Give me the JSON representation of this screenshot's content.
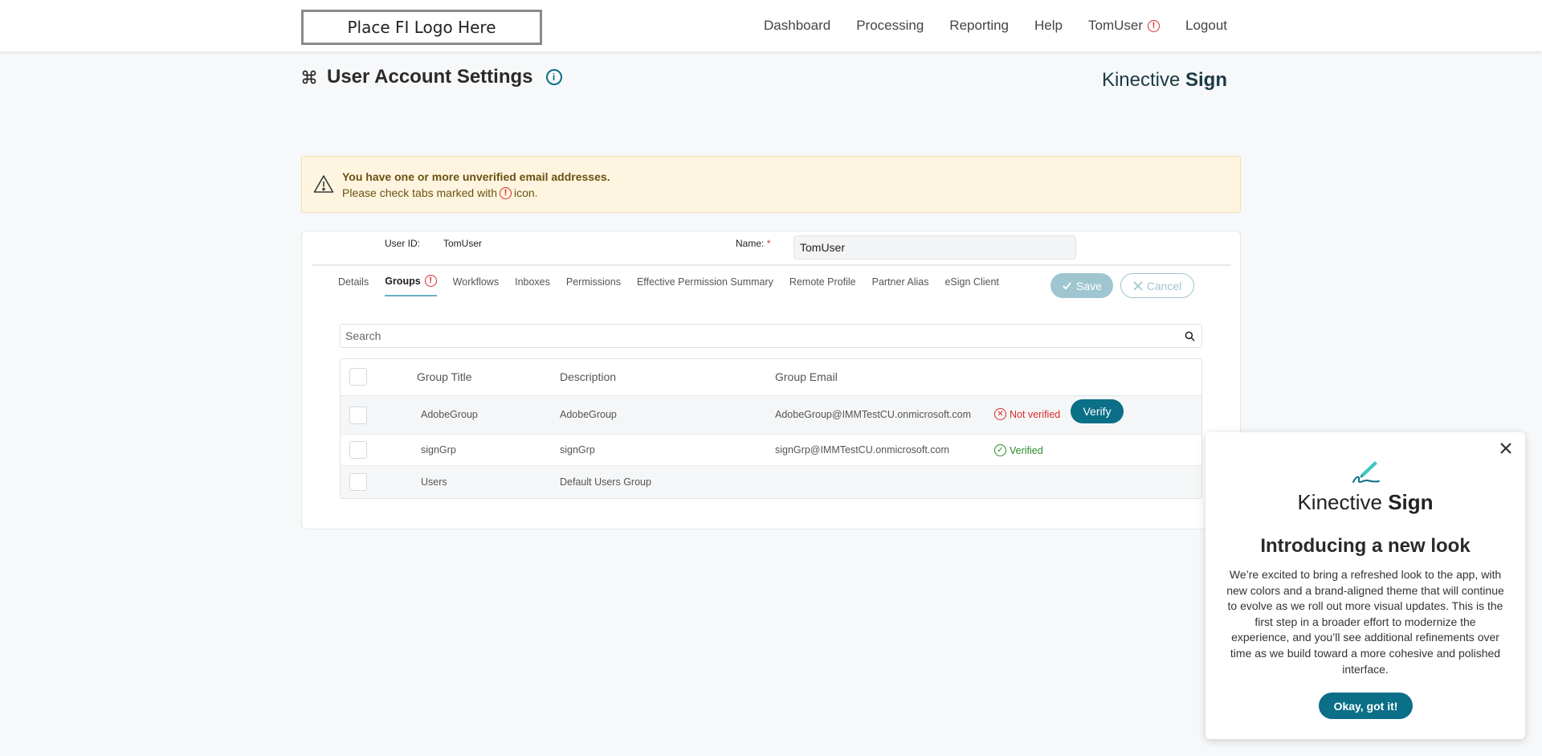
{
  "header": {
    "logo_text": "Place FI Logo Here",
    "nav": [
      {
        "label": "Dashboard"
      },
      {
        "label": "Processing"
      },
      {
        "label": "Reporting"
      },
      {
        "label": "Help"
      },
      {
        "label": "TomUser",
        "alert": true
      },
      {
        "label": "Logout"
      }
    ]
  },
  "page": {
    "title": "User Account Settings",
    "brand": {
      "light": "Kinective",
      "bold": "Sign"
    }
  },
  "warning": {
    "title": "You have one or more unverified email addresses.",
    "sub_before": "Please check tabs marked with",
    "sub_after": "icon."
  },
  "user": {
    "id_label": "User ID:",
    "id_value": "TomUser",
    "name_label": "Name:",
    "name_required": "*",
    "name_value": "TomUser"
  },
  "tabs": [
    {
      "label": "Details",
      "active": false
    },
    {
      "label": "Groups",
      "active": true,
      "alert": true
    },
    {
      "label": "Workflows",
      "active": false
    },
    {
      "label": "Inboxes",
      "active": false
    },
    {
      "label": "Permissions",
      "active": false
    },
    {
      "label": "Effective Permission Summary",
      "active": false
    },
    {
      "label": "Remote Profile",
      "active": false
    },
    {
      "label": "Partner Alias",
      "active": false
    },
    {
      "label": "eSign Client",
      "active": false
    }
  ],
  "actions": {
    "save": "Save",
    "cancel": "Cancel"
  },
  "search": {
    "placeholder": "Search"
  },
  "table": {
    "columns": [
      "Group Title",
      "Description",
      "Group Email"
    ],
    "rows": [
      {
        "title": "AdobeGroup",
        "description": "AdobeGroup",
        "email": "AdobeGroup@IMMTestCU.onmicrosoft.com",
        "status": "Not verified",
        "action": "Verify"
      },
      {
        "title": "signGrp",
        "description": "signGrp",
        "email": "signGrp@IMMTestCU.onmicrosoft.com",
        "status": "Verified"
      },
      {
        "title": "Users",
        "description": "Default Users Group",
        "email": "",
        "status": ""
      }
    ]
  },
  "popup": {
    "brand": {
      "light": "Kinective",
      "bold": "Sign"
    },
    "title": "Introducing a new look",
    "body": "We’re excited to bring a refreshed look to the app, with new colors and a brand-aligned theme that will continue to evolve as we roll out more visual updates. This is the first step in a broader effort to modernize the experience, and you’ll see additional refinements over time as we build toward a more cohesive and polished interface.",
    "button": "Okay, got it!"
  },
  "colors": {
    "accent": "#0b6f87",
    "error": "#d92b2b",
    "success": "#2b8a2b",
    "warning_bg": "#fdf5e0"
  }
}
